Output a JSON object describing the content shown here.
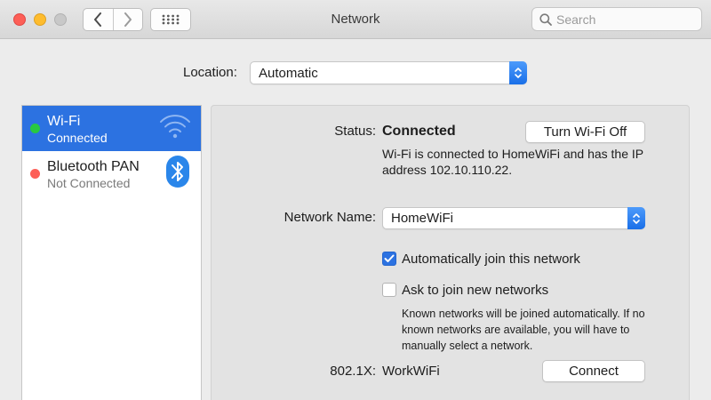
{
  "window": {
    "title": "Network",
    "search_placeholder": "Search"
  },
  "location": {
    "label": "Location:",
    "value": "Automatic"
  },
  "services": [
    {
      "name": "Wi-Fi",
      "status": "Connected",
      "status_color": "#28c840",
      "icon": "wifi-icon",
      "selected": true
    },
    {
      "name": "Bluetooth PAN",
      "status": "Not Connected",
      "status_color": "#fd5f57",
      "icon": "bluetooth-icon",
      "selected": false
    }
  ],
  "detail": {
    "status_label": "Status:",
    "status_value": "Connected",
    "toggle_button": "Turn Wi-Fi Off",
    "status_description": "Wi-Fi is connected to HomeWiFi and has the IP address 102.10.110.22.",
    "network_name_label": "Network Name:",
    "network_name_value": "HomeWiFi",
    "auto_join_label": "Automatically join this network",
    "auto_join_checked": true,
    "ask_join_label": "Ask to join new networks",
    "ask_join_checked": false,
    "ask_join_help": "Known networks will be joined automatically. If no known networks are available, you will have to manually select a network.",
    "dot1x_label": "802.1X:",
    "dot1x_value": "WorkWiFi",
    "connect_button": "Connect"
  },
  "colors": {
    "accent": "#2c72e1",
    "connected": "#28c840",
    "disconnected": "#fd5f57"
  }
}
